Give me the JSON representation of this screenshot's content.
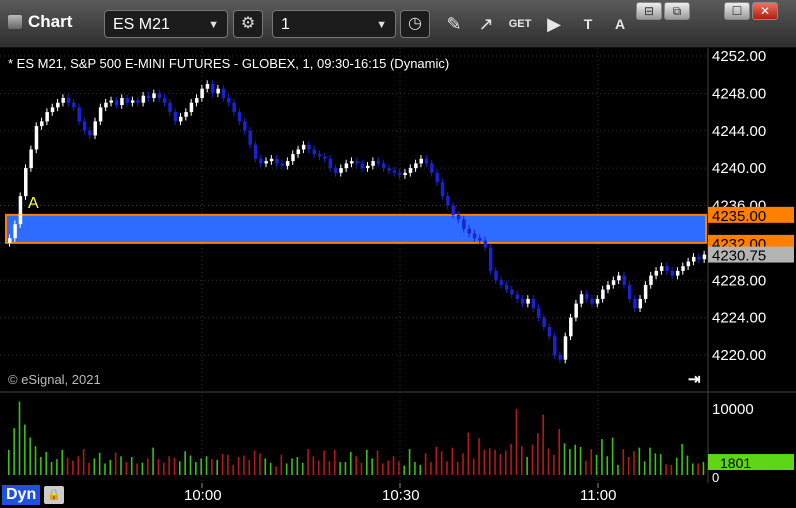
{
  "window": {
    "title": "Chart",
    "symbol": "ES M21",
    "interval": "1",
    "win_buttons": [
      "⊟",
      "⧉",
      "☐",
      "✕"
    ]
  },
  "toolbar_icons": [
    "gear-icon",
    "clock-icon",
    "pencil-icon",
    "cursor-icon",
    "get-icon",
    "play-icon",
    "text-icon",
    "alert-icon"
  ],
  "chart_header": "* ES M21, S&P 500 E-MINI FUTURES - GLOBEX, 1, 09:30-16:15 (Dynamic)",
  "copyright": "© eSignal, 2021",
  "marker_label": "A",
  "bottom": {
    "mode_label": "Dyn"
  },
  "colors": {
    "up": "#ffffff",
    "down": "#1a22d6",
    "band": "#2d6cff",
    "band_border": "#ff7f00",
    "last": "#b4b4b4",
    "vol_up": "#39c21c",
    "vol_down": "#b81818"
  },
  "chart_data": {
    "type": "candlestick",
    "price_axis": {
      "ticks": [
        4252,
        4248,
        4244,
        4240,
        4236,
        4232,
        4228,
        4224,
        4220
      ],
      "labels": [
        "4252.00",
        "4248.00",
        "4244.00",
        "4240.00",
        "4236.00",
        "4232.00",
        "4228.00",
        "4224.00",
        "4220.00"
      ]
    },
    "time_axis": {
      "labels": [
        "10:00",
        "10:30",
        "11:00"
      ]
    },
    "band": {
      "upper": 4235.0,
      "lower": 4232.0,
      "upper_label": "4235.00",
      "lower_label": "4232.00"
    },
    "last_price": {
      "value": 4230.75,
      "label": "4230.75"
    },
    "volume_axis": {
      "labels": [
        "10000",
        "0"
      ]
    },
    "volume_last": {
      "value": 1801,
      "label": "1801"
    },
    "closes": [
      4232.5,
      4234,
      4237,
      4240,
      4242,
      4244.5,
      4245,
      4246,
      4246.5,
      4247,
      4247.5,
      4247,
      4246.5,
      4245,
      4244,
      4243.5,
      4245,
      4246.5,
      4247,
      4247.25,
      4246.75,
      4247.5,
      4247,
      4247.25,
      4247,
      4247.75,
      4247.5,
      4248,
      4247.5,
      4247,
      4246,
      4245,
      4245.5,
      4246,
      4247,
      4247.5,
      4248.5,
      4249,
      4248,
      4248.5,
      4247.5,
      4247,
      4246,
      4245,
      4244,
      4242.5,
      4241,
      4240.5,
      4240.75,
      4241,
      4240.5,
      4240.25,
      4240.75,
      4241.5,
      4242,
      4242.5,
      4242,
      4241.5,
      4241.25,
      4241,
      4240,
      4239.5,
      4240,
      4240.5,
      4240.75,
      4240.5,
      4240,
      4240.25,
      4240.75,
      4240.5,
      4240,
      4239.75,
      4239.5,
      4239.25,
      4239.5,
      4240,
      4240.5,
      4241,
      4240.5,
      4239.5,
      4238.5,
      4237,
      4236,
      4235,
      4234.5,
      4233.5,
      4233,
      4232.5,
      4232.25,
      4231.5,
      4229,
      4228,
      4227.5,
      4227,
      4226.5,
      4226,
      4225.5,
      4226,
      4225,
      4224,
      4223,
      4222,
      4220,
      4219.5,
      4222,
      4224,
      4225.5,
      4226.5,
      4226,
      4225.5,
      4226,
      4227,
      4227.5,
      4228,
      4228.5,
      4227.5,
      4226,
      4225,
      4226,
      4227.5,
      4228.5,
      4229,
      4229.5,
      4229,
      4228.5,
      4229,
      4229.5,
      4230,
      4230.5,
      4230.25,
      4230.75
    ],
    "volumes": [
      3500,
      6500,
      10200,
      7000,
      5200,
      4000,
      2500,
      3200,
      1800,
      2200,
      3500,
      2400,
      2000,
      2600,
      3600,
      1700,
      2300,
      3100,
      1600,
      2100,
      3100,
      2600,
      1800,
      2500,
      1600,
      1700,
      2300,
      3800,
      2200,
      1700,
      2600,
      2400,
      1900,
      3300,
      2700,
      1800,
      2300,
      2600,
      2200,
      2100,
      2900,
      2800,
      1400,
      2500,
      2700,
      2100,
      3400,
      3000,
      2300,
      1700,
      1200,
      2800,
      1600,
      2300,
      2500,
      1700,
      3600,
      2600,
      2000,
      3400,
      1900,
      3500,
      1800,
      1800,
      3200,
      2600,
      1700,
      3500,
      2300,
      3400,
      1600,
      2000,
      2600,
      1900,
      1300,
      3600,
      1800,
      1400,
      3000,
      1800,
      3900,
      3300,
      1900,
      3800,
      1800,
      3000,
      5900,
      2300,
      5100,
      3500,
      3700,
      3500,
      2900,
      3400,
      4300,
      9200,
      4000,
      2500,
      4200,
      5800,
      8400,
      3700,
      2800,
      6400,
      4400,
      3600,
      4200,
      3900,
      2000,
      3600,
      2800,
      5000,
      2600,
      5200,
      1400,
      3600,
      2500,
      3300,
      3800,
      1900,
      3800,
      3000,
      2900,
      1500,
      1400,
      2400,
      4300,
      2700,
      1600,
      1600,
      1801
    ]
  }
}
